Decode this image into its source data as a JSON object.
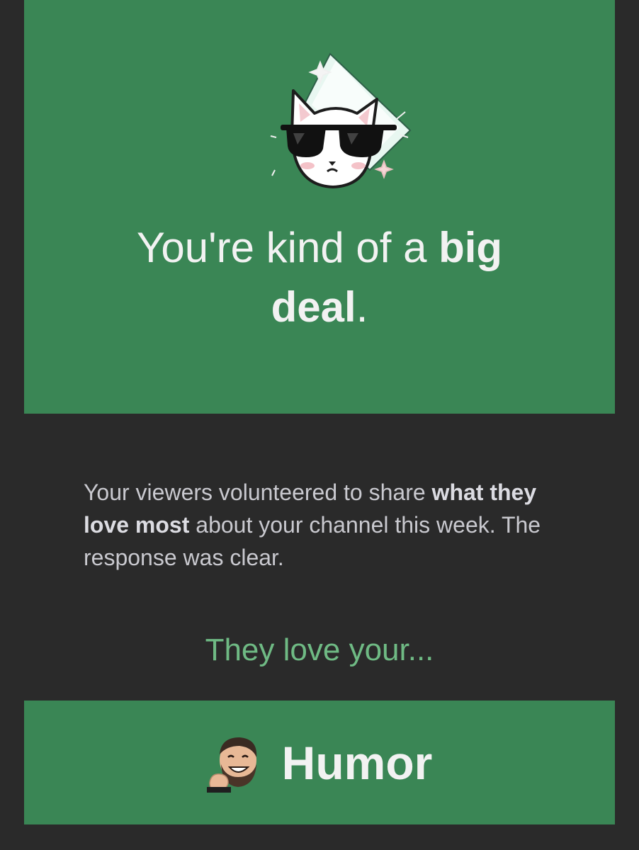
{
  "hero": {
    "headline_part1": "You're kind of a ",
    "headline_bold1": "big",
    "headline_bold2": "deal",
    "headline_end": ".",
    "illustration_icon": "cool-cat-sunglasses-icon"
  },
  "body": {
    "intro": "Your viewers volunteered to share ",
    "emphasis": "what they love most",
    "rest": " about your channel this week. The response was clear."
  },
  "love_line": "They love your...",
  "result": {
    "icon": "laughing-man-emote-icon",
    "label": "Humor"
  },
  "colors": {
    "background": "#2a2a2a",
    "panel": "#3a8655",
    "accent_text": "#6fba84",
    "headline_text": "#f2f2f2",
    "body_text": "#c9c9cf"
  }
}
